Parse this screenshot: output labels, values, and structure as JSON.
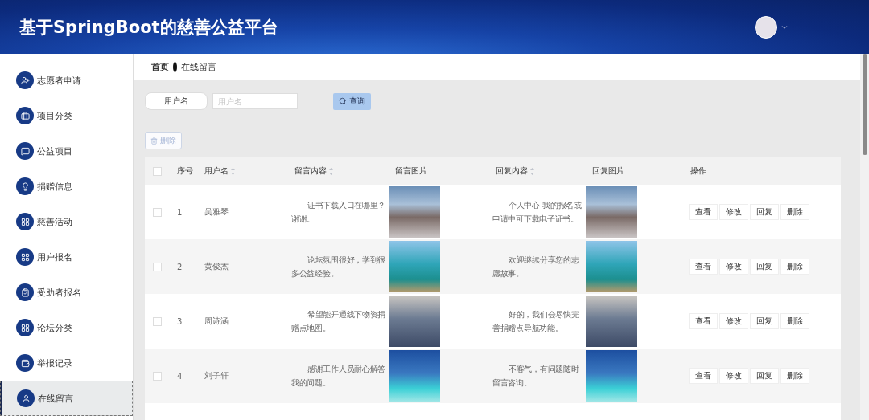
{
  "header": {
    "title": "基于SpringBoot的慈善公益平台"
  },
  "sidebar": {
    "items": [
      {
        "label": "志愿者申请",
        "selected": false
      },
      {
        "label": "项目分类",
        "selected": false
      },
      {
        "label": "公益项目",
        "selected": false
      },
      {
        "label": "捐赠信息",
        "selected": false
      },
      {
        "label": "慈善活动",
        "selected": false
      },
      {
        "label": "用户报名",
        "selected": false
      },
      {
        "label": "受助者报名",
        "selected": false
      },
      {
        "label": "论坛分类",
        "selected": false
      },
      {
        "label": "举报记录",
        "selected": false
      },
      {
        "label": "在线留言",
        "selected": true
      }
    ]
  },
  "breadcrumb": {
    "home": "首页",
    "current": "在线留言"
  },
  "search": {
    "label": "用户名",
    "placeholder": "用户名",
    "button": "查询"
  },
  "delete_button": "删除",
  "table": {
    "select_all_checked": false,
    "columns": [
      {
        "label": "序号",
        "sortable": false
      },
      {
        "label": "用户名",
        "sortable": true
      },
      {
        "label": "留言内容",
        "sortable": true
      },
      {
        "label": "留言图片",
        "sortable": false
      },
      {
        "label": "回复内容",
        "sortable": true
      },
      {
        "label": "回复图片",
        "sortable": false
      },
      {
        "label": "操作",
        "sortable": false
      }
    ],
    "rows": [
      {
        "checked": false,
        "index": "1",
        "user": "吴雅琴",
        "message": "证书下载入口在哪里？谢谢。",
        "reply": "个人中心-我的报名或申请中可下载电子证书。",
        "actions": [
          "查看",
          "修改",
          "回复",
          "删除"
        ]
      },
      {
        "checked": false,
        "index": "2",
        "user": "黄俊杰",
        "message": "论坛氛围很好，学到很多公益经验。",
        "reply": "欢迎继续分享您的志愿故事。",
        "actions": [
          "查看",
          "修改",
          "回复",
          "删除"
        ]
      },
      {
        "checked": false,
        "index": "3",
        "user": "周诗涵",
        "message": "希望能开通线下物资捐赠点地图。",
        "reply": "好的，我们会尽快完善捐赠点导航功能。",
        "actions": [
          "查看",
          "修改",
          "回复",
          "删除"
        ]
      },
      {
        "checked": false,
        "index": "4",
        "user": "刘子轩",
        "message": "感谢工作人员耐心解答我的问题。",
        "reply": "不客气，有问题随时留言咨询。",
        "actions": [
          "查看",
          "修改",
          "回复",
          "删除"
        ]
      }
    ]
  }
}
